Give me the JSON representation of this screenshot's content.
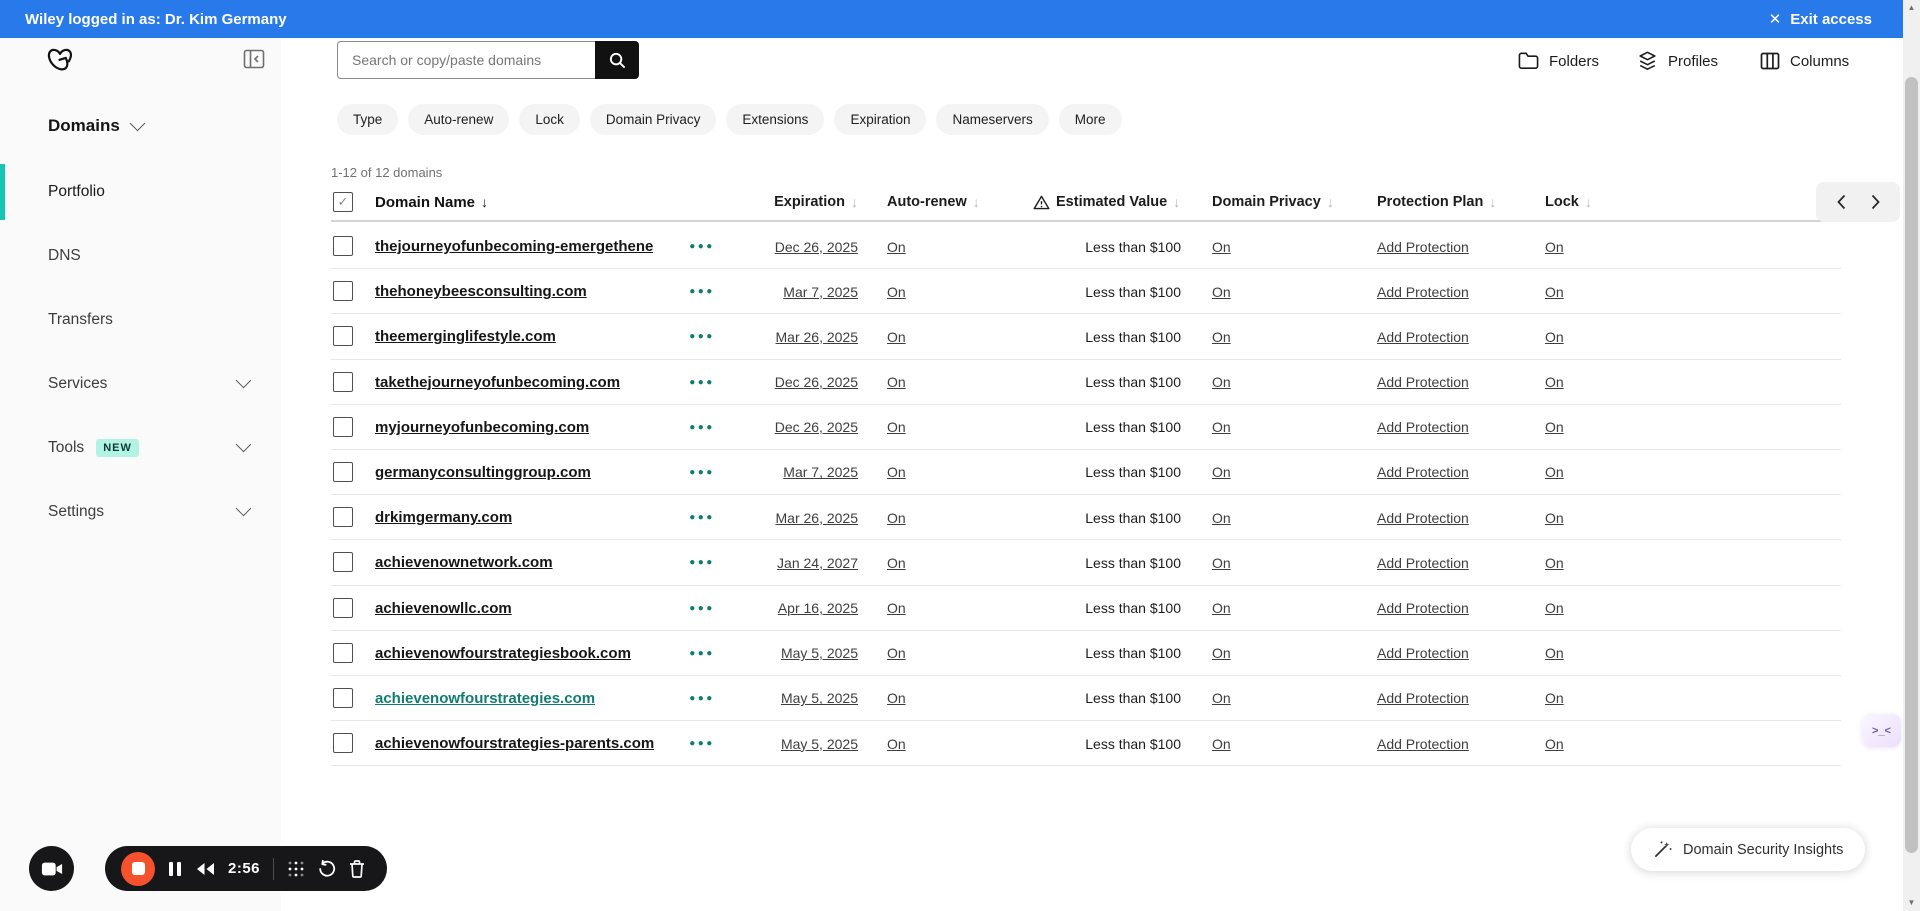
{
  "colors": {
    "banner_blue": "#2879e9",
    "accent_teal": "#17c5b4",
    "link_teal": "#117c72",
    "record_red": "#f5512d"
  },
  "banner": {
    "text": "Wiley logged in as: Dr. Kim Germany",
    "exit_label": "Exit access"
  },
  "sidebar": {
    "heading": "Domains",
    "items": [
      {
        "label": "Portfolio",
        "active": true
      },
      {
        "label": "DNS"
      },
      {
        "label": "Transfers"
      },
      {
        "label": "Services",
        "expandable": true
      },
      {
        "label": "Tools",
        "badge": "NEW",
        "expandable": true
      },
      {
        "label": "Settings",
        "expandable": true
      }
    ]
  },
  "toolbar": {
    "search_placeholder": "Search or copy/paste domains",
    "actions": [
      {
        "label": "Folders"
      },
      {
        "label": "Profiles"
      },
      {
        "label": "Columns"
      }
    ]
  },
  "filters": [
    "Type",
    "Auto-renew",
    "Lock",
    "Domain Privacy",
    "Extensions",
    "Expiration",
    "Nameservers",
    "More"
  ],
  "table": {
    "count_text": "1-12 of 12 domains",
    "columns": [
      "Domain Name",
      "Expiration",
      "Auto-renew",
      "Estimated Value",
      "Domain Privacy",
      "Protection Plan",
      "Lock"
    ],
    "rows": [
      {
        "domain": "thejourneyofunbecoming-emergethene",
        "expiration": "Dec 26, 2025",
        "auto_renew": "On",
        "estimated_value": "Less than $100",
        "privacy": "On",
        "protection": "Add Protection",
        "lock": "On",
        "highlighted": false
      },
      {
        "domain": "thehoneybeesconsulting.com",
        "expiration": "Mar 7, 2025",
        "auto_renew": "On",
        "estimated_value": "Less than $100",
        "privacy": "On",
        "protection": "Add Protection",
        "lock": "On",
        "highlighted": false
      },
      {
        "domain": "theemerginglifestyle.com",
        "expiration": "Mar 26, 2025",
        "auto_renew": "On",
        "estimated_value": "Less than $100",
        "privacy": "On",
        "protection": "Add Protection",
        "lock": "On",
        "highlighted": false
      },
      {
        "domain": "takethejourneyofunbecoming.com",
        "expiration": "Dec 26, 2025",
        "auto_renew": "On",
        "estimated_value": "Less than $100",
        "privacy": "On",
        "protection": "Add Protection",
        "lock": "On",
        "highlighted": false
      },
      {
        "domain": "myjourneyofunbecoming.com",
        "expiration": "Dec 26, 2025",
        "auto_renew": "On",
        "estimated_value": "Less than $100",
        "privacy": "On",
        "protection": "Add Protection",
        "lock": "On",
        "highlighted": false
      },
      {
        "domain": "germanyconsultinggroup.com",
        "expiration": "Mar 7, 2025",
        "auto_renew": "On",
        "estimated_value": "Less than $100",
        "privacy": "On",
        "protection": "Add Protection",
        "lock": "On",
        "highlighted": false
      },
      {
        "domain": "drkimgermany.com",
        "expiration": "Mar 26, 2025",
        "auto_renew": "On",
        "estimated_value": "Less than $100",
        "privacy": "On",
        "protection": "Add Protection",
        "lock": "On",
        "highlighted": false
      },
      {
        "domain": "achievenownetwork.com",
        "expiration": "Jan 24, 2027",
        "auto_renew": "On",
        "estimated_value": "Less than $100",
        "privacy": "On",
        "protection": "Add Protection",
        "lock": "On",
        "highlighted": false
      },
      {
        "domain": "achievenowllc.com",
        "expiration": "Apr 16, 2025",
        "auto_renew": "On",
        "estimated_value": "Less than $100",
        "privacy": "On",
        "protection": "Add Protection",
        "lock": "On",
        "highlighted": false
      },
      {
        "domain": "achievenowfourstrategiesbook.com",
        "expiration": "May 5, 2025",
        "auto_renew": "On",
        "estimated_value": "Less than $100",
        "privacy": "On",
        "protection": "Add Protection",
        "lock": "On",
        "highlighted": false
      },
      {
        "domain": "achievenowfourstrategies.com",
        "expiration": "May 5, 2025",
        "auto_renew": "On",
        "estimated_value": "Less than $100",
        "privacy": "On",
        "protection": "Add Protection",
        "lock": "On",
        "highlighted": true
      },
      {
        "domain": "achievenowfourstrategies-parents.com",
        "expiration": "May 5, 2025",
        "auto_renew": "On",
        "estimated_value": "Less than $100",
        "privacy": "On",
        "protection": "Add Protection",
        "lock": "On",
        "highlighted": false
      }
    ]
  },
  "recorder": {
    "time": "2:56"
  },
  "fab": {
    "label": "Domain Security Insights"
  },
  "widget": {
    "face": ">_<"
  }
}
